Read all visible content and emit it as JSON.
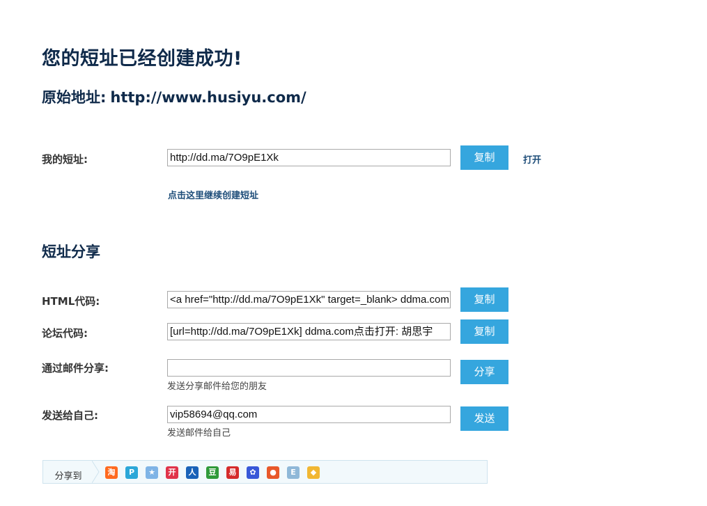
{
  "header": {
    "title": "您的短址已经创建成功!",
    "original_prefix": "原始地址:",
    "original_url": "http://www.husiyu.com/"
  },
  "my_short": {
    "label": "我的短址:",
    "value": "http://dd.ma/7O9pE1Xk",
    "copy_label": "复制",
    "open_label": "打开",
    "continue_link": "点击这里继续创建短址"
  },
  "share": {
    "heading": "短址分享",
    "html_code": {
      "label": "HTML代码:",
      "value": "<a href=\"http://dd.ma/7O9pE1Xk\" target=_blank> ddma.com",
      "button": "复制"
    },
    "forum_code": {
      "label": "论坛代码:",
      "value": "[url=http://dd.ma/7O9pE1Xk] ddma.com点击打开: 胡思宇",
      "button": "复制"
    },
    "email_share": {
      "label": "通过邮件分享:",
      "value": "",
      "hint": "发送分享邮件给您的朋友",
      "button": "分享"
    },
    "send_self": {
      "label": "发送给自己:",
      "value": "vip58694@qq.com",
      "hint": "发送邮件给自己",
      "button": "发送"
    }
  },
  "share_bar": {
    "label": "分享到",
    "icons": [
      {
        "name": "taobao-icon",
        "glyph": "淘",
        "color": "#ff6a1f"
      },
      {
        "name": "qzone-icon",
        "glyph": "P",
        "color": "#2ba7d8"
      },
      {
        "name": "favorite-star-icon",
        "glyph": "★",
        "color": "#7fb4e6"
      },
      {
        "name": "kaixin-icon",
        "glyph": "开",
        "color": "#e0334a"
      },
      {
        "name": "renren-icon",
        "glyph": "人",
        "color": "#1a62b8"
      },
      {
        "name": "douban-icon",
        "glyph": "豆",
        "color": "#2f9a3a"
      },
      {
        "name": "yi-icon",
        "glyph": "易",
        "color": "#d52b2b"
      },
      {
        "name": "baidu-icon",
        "glyph": "✿",
        "color": "#3858d8"
      },
      {
        "name": "apple-fruit-icon",
        "glyph": "●",
        "color": "#e8582a"
      },
      {
        "name": "note-icon",
        "glyph": "E",
        "color": "#8fb8d8"
      },
      {
        "name": "bookmark-icon",
        "glyph": "◆",
        "color": "#f1b733"
      }
    ]
  }
}
